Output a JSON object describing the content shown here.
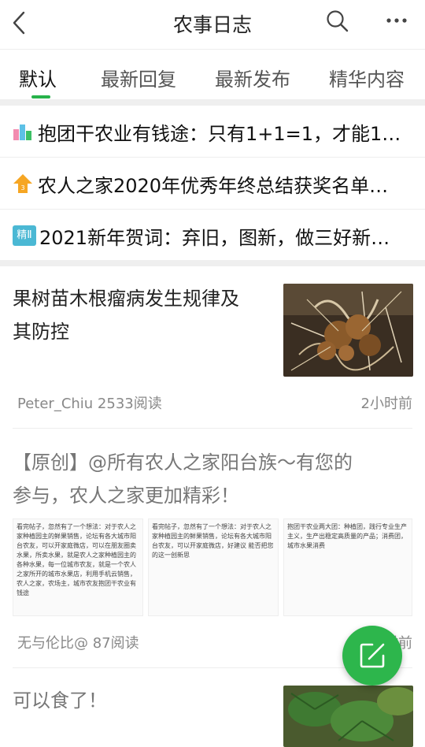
{
  "header": {
    "title": "农事日志"
  },
  "tabs": [
    {
      "label": "默认"
    },
    {
      "label": "最新回复"
    },
    {
      "label": "最新发布"
    },
    {
      "label": "精华内容"
    }
  ],
  "pinned": [
    {
      "icon": "bar-chart-icon",
      "text": "抱团干农业有钱途：只有1+1=1，才能1…"
    },
    {
      "icon": "pin-top-icon",
      "text": "农人之家2020年优秀年终总结获奖名单…"
    },
    {
      "icon": "essence-badge-icon",
      "badge": "精Ⅱ",
      "text": "2021新年贺词：弃旧，图新，做三好新…"
    }
  ],
  "posts": [
    {
      "title_line1": "果树苗木根瘤病发生规律及",
      "title_line2": "其防控",
      "meta": "Peter_Chiu 2533阅读",
      "time": "2小时前"
    },
    {
      "title_line1": "【原创】@所有农人之家阳台族～有您的",
      "title_line2": "参与，农人之家更加精彩！",
      "shots": [
        "看完帖子，忽然有了一个想法：对于农人之家种植园主的鲜果销售，论坛有各大城市阳台农友，可以开家庭微店，可以在朋友圈卖水果，所卖水果，就是农人之家种植园主的各种水果，每一位城市农友，就是一个农人之家所开的城市水果店，利用手机云销售，农人之家，农场主，城市农友抱团干农业有钱途",
        "看完帖子，忽然有了一个想法：对于农人之家种植园主的鲜果销售，论坛有各大城市阳台农友，可以开家庭微店，好建议 能否把您的这一创新思",
        "抱团干农业两大团：种植团，践行专业生产主义，生产出稳定高质量的产品；消费团，城市水果消费"
      ],
      "meta": "无与伦比@ 87阅读",
      "time": "3小时前"
    },
    {
      "title_line1": "可以食了！"
    }
  ],
  "colors": {
    "accent": "#27b24a",
    "fab": "#2db64c"
  },
  "fab": {
    "icon": "edit-icon"
  }
}
